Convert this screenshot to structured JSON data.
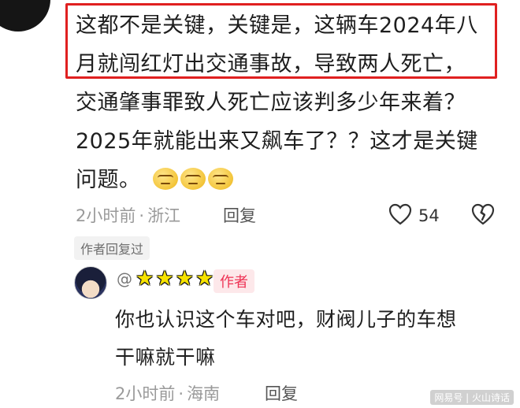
{
  "comment": {
    "lines": [
      "这都不是关键，关键是，这辆车2024年八",
      "月就闯红灯出交通事故，导致两人死亡，",
      "交通肇事罪致人死亡应该判多少年来着？",
      "2025年就能出来又飙车了？？这才是关键",
      "问题。"
    ],
    "emoji_count": 3,
    "emoji_icon": "thinking-face-emoji",
    "time": "2小时前",
    "location": "浙江",
    "reply_label": "回复",
    "like_count": "54"
  },
  "author_replied_tag": "作者回复过",
  "reply": {
    "username_prefix": "@",
    "username_stars": [
      "★",
      "★",
      "★",
      "★"
    ],
    "author_badge": "作者",
    "lines": [
      "你也认识这个车对吧，财阀儿子的车想",
      "干嘛就干嘛"
    ],
    "time": "2小时前",
    "location": "海南",
    "reply_label": "回复"
  },
  "watermark": "网易号 | 火山诗话",
  "colors": {
    "highlight_border": "#e02020",
    "badge_text": "#ee3355",
    "badge_bg": "#fde8ea",
    "star_fill": "#f7e300",
    "meta_gray": "#9a9a9a"
  }
}
